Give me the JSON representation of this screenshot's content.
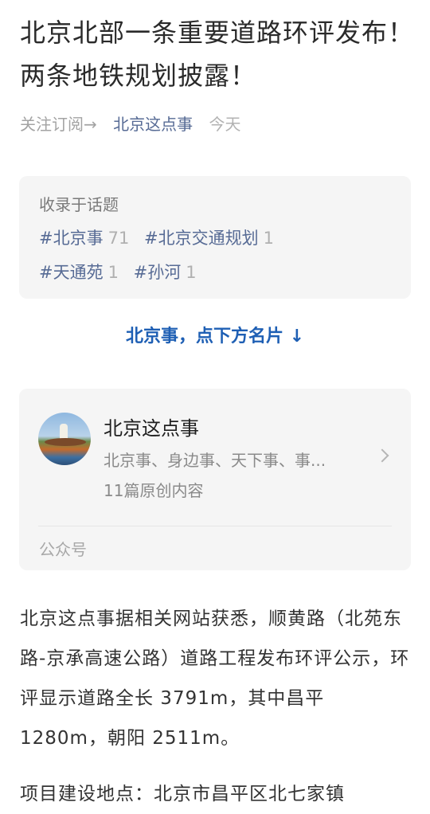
{
  "article": {
    "title": "北京北部一条重要道路环评发布！两条地铁规划披露！",
    "follow": "关注订阅→",
    "account": "北京这点事",
    "date": "今天"
  },
  "topics": {
    "heading": "收录于话题",
    "tags": [
      {
        "name": "#北京事",
        "count": "71"
      },
      {
        "name": "#北京交通规划",
        "count": "1"
      },
      {
        "name": "#天通苑",
        "count": "1"
      },
      {
        "name": "#孙河",
        "count": "1"
      }
    ]
  },
  "cta": "北京事，点下方名片 ↓",
  "card": {
    "name": "北京这点事",
    "desc": "北京事、身边事、天下事、事...",
    "count": "11篇原创内容",
    "type": "公众号",
    "icon": "chevron-right-icon"
  },
  "body": {
    "p1": "北京这点事据相关网站获悉，顺黄路（北苑东路-京承高速公路）道路工程发布环评公示，环评显示道路全长 3791m，其中昌平 1280m，朝阳 2511m。",
    "p2": "项目建设地点：北京市昌平区北七家镇"
  }
}
